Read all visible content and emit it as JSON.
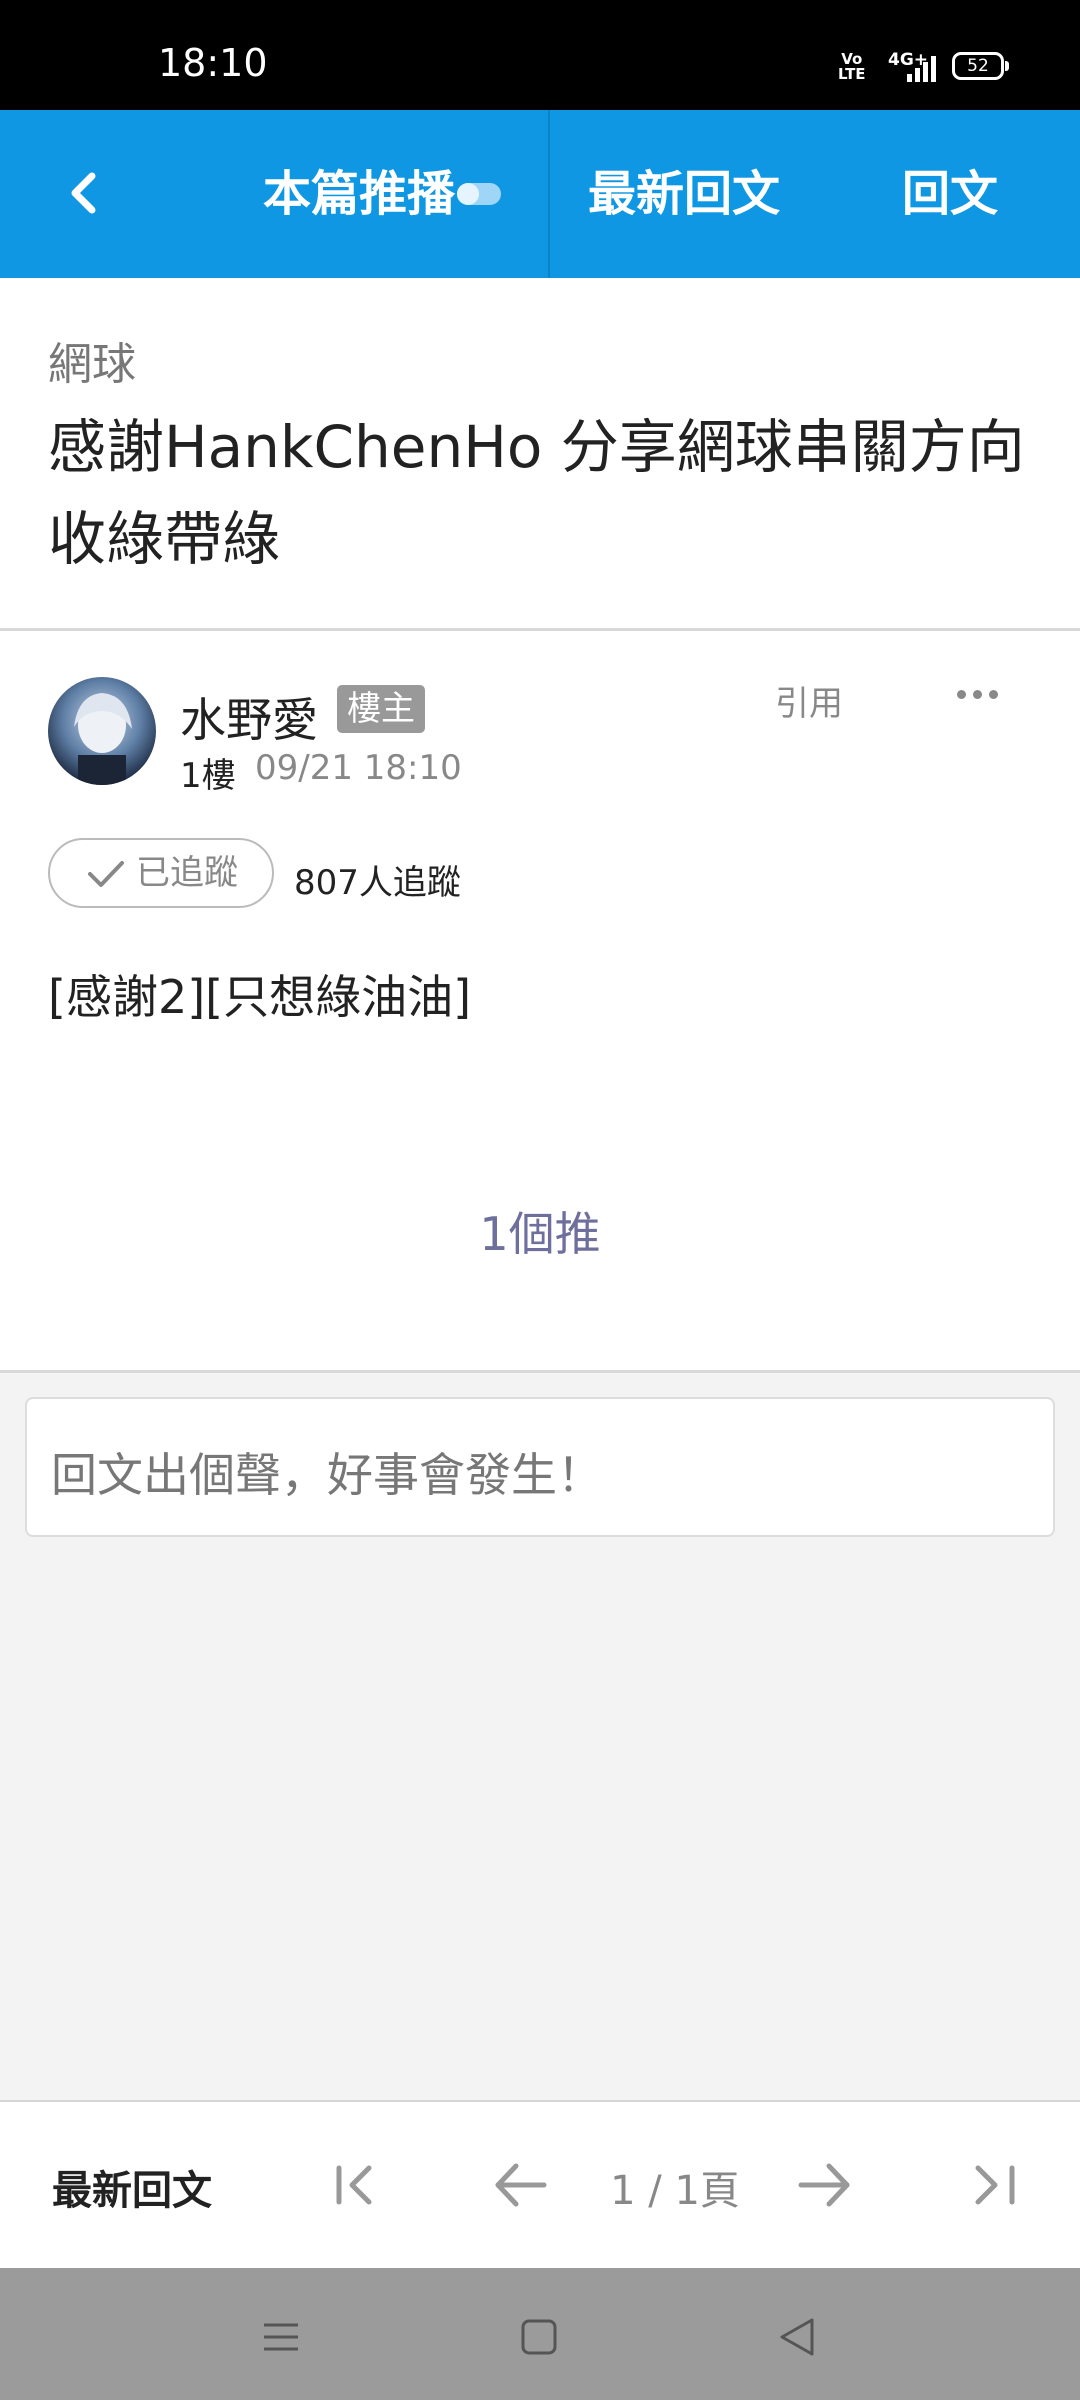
{
  "status_bar": {
    "time": "18:10",
    "volte": "Vo LTE",
    "network": "4G+",
    "battery": "52"
  },
  "header": {
    "tab_push": "本篇推播",
    "tab_latest": "最新回文",
    "tab_reply": "回文"
  },
  "post": {
    "category": "網球",
    "title": "感謝HankChenHo 分享網球串關方向收綠帶綠",
    "author": "水野愛",
    "op_badge": "樓主",
    "floor": "1樓",
    "datetime": "09/21 18:10",
    "quote_label": "引用",
    "follow_label": "已追蹤",
    "follower_count": "807人追蹤",
    "body": "[感謝2][只想綠油油]",
    "push_count": "1個推"
  },
  "reply": {
    "placeholder": "回文出個聲，好事會發生！"
  },
  "pager": {
    "latest_label": "最新回文",
    "page_indicator": "1 / 1頁"
  },
  "colors": {
    "header_bg": "#0f97e3",
    "push_text": "#6f6f9e"
  }
}
